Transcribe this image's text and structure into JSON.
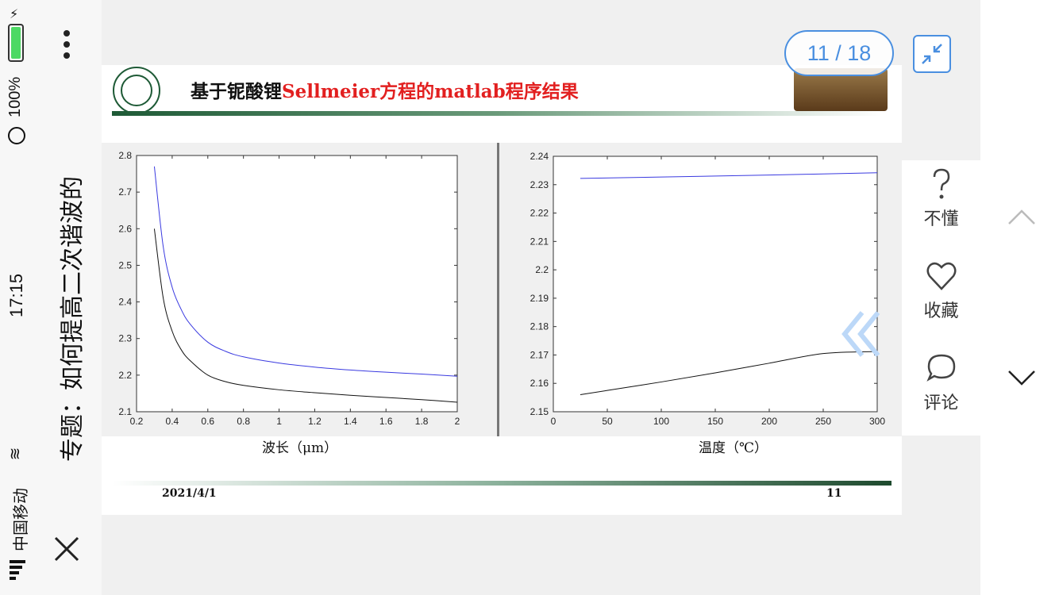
{
  "status": {
    "time": "17:15",
    "battery": "100%",
    "carrier": "中国移动"
  },
  "doc_title": "专题：如何提高二次谐波的",
  "pager": {
    "label": "11 / 18"
  },
  "slide": {
    "title_prefix": "基于铌酸锂",
    "title_highlight": "Sellmeier方程的matlab程序结果",
    "date": "2021/4/1",
    "number": "11"
  },
  "side_actions": [
    {
      "label": "不懂",
      "icon": "question-icon"
    },
    {
      "label": "收藏",
      "icon": "heart-icon"
    },
    {
      "label": "评论",
      "icon": "comment-icon"
    }
  ],
  "colors": {
    "accent": "#4a8fe0",
    "series_blue": "#3a3ae0",
    "series_black": "#111111"
  },
  "chart_data": [
    {
      "type": "line",
      "xlabel": "波长（μm）",
      "ylabel": "",
      "xlim": [
        0.2,
        2
      ],
      "ylim": [
        2.1,
        2.8
      ],
      "xticks": [
        0.2,
        0.4,
        0.6,
        0.8,
        1,
        1.2,
        1.4,
        1.6,
        1.8,
        2
      ],
      "yticks": [
        2.1,
        2.2,
        2.3,
        2.4,
        2.5,
        2.6,
        2.7,
        2.8
      ],
      "grid": false,
      "series": [
        {
          "color": "#3a3ae0",
          "x": [
            0.3,
            0.35,
            0.4,
            0.45,
            0.5,
            0.6,
            0.7,
            0.8,
            1.0,
            1.2,
            1.4,
            1.6,
            1.8,
            2.0
          ],
          "y": [
            2.77,
            2.55,
            2.44,
            2.38,
            2.34,
            2.29,
            2.265,
            2.25,
            2.233,
            2.222,
            2.214,
            2.208,
            2.203,
            2.197
          ]
        },
        {
          "color": "#111111",
          "x": [
            0.3,
            0.35,
            0.4,
            0.45,
            0.5,
            0.6,
            0.7,
            0.8,
            1.0,
            1.2,
            1.4,
            1.6,
            1.8,
            2.0
          ],
          "y": [
            2.6,
            2.41,
            2.32,
            2.27,
            2.24,
            2.2,
            2.182,
            2.172,
            2.16,
            2.152,
            2.145,
            2.139,
            2.133,
            2.126
          ]
        }
      ]
    },
    {
      "type": "line",
      "xlabel": "温度（℃）",
      "ylabel": "",
      "xlim": [
        0,
        300
      ],
      "ylim": [
        2.15,
        2.24
      ],
      "xticks": [
        0,
        50,
        100,
        150,
        200,
        250,
        300
      ],
      "yticks": [
        2.15,
        2.16,
        2.17,
        2.18,
        2.19,
        2.2,
        2.21,
        2.22,
        2.23,
        2.24
      ],
      "grid": false,
      "series": [
        {
          "color": "#3a3ae0",
          "x": [
            25,
            100,
            200,
            300
          ],
          "y": [
            2.2322,
            2.2327,
            2.2334,
            2.2342
          ]
        },
        {
          "color": "#111111",
          "x": [
            25,
            50,
            100,
            150,
            200,
            250,
            300
          ],
          "y": [
            2.156,
            2.1575,
            2.1605,
            2.1637,
            2.1671,
            2.1705,
            2.1712
          ]
        }
      ]
    }
  ]
}
